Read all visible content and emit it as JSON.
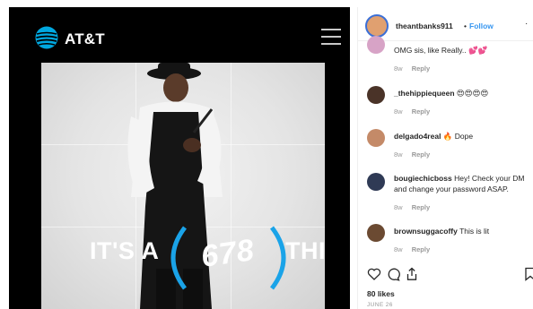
{
  "brand": {
    "name": "AT&T"
  },
  "media": {
    "tagline_left": "IT'S A",
    "tagline_number": "678",
    "tagline_right": "THING"
  },
  "post_header": {
    "username": "theantbanks911",
    "separator": "•",
    "follow_label": "Follow"
  },
  "comments": [
    {
      "username": "",
      "text": "OMG sis, like Really.. 💕💕",
      "age": "8w",
      "reply_label": "Reply"
    },
    {
      "username": "_thehippiequeen",
      "text": "😍😍😍😍",
      "age": "8w",
      "reply_label": "Reply"
    },
    {
      "username": "delgado4real",
      "text": "🔥 Dope",
      "age": "8w",
      "reply_label": "Reply"
    },
    {
      "username": "bougiechicboss",
      "text": "Hey! Check your DM",
      "text_line2": "and change your password ASAP.",
      "age": "8w",
      "reply_label": "Reply"
    },
    {
      "username": "brownsuggacoffy",
      "text": "This is lit",
      "age": "8w",
      "reply_label": "Reply"
    }
  ],
  "engagement": {
    "likes": "80 likes",
    "date": "JUNE 26"
  },
  "colors": {
    "accent_blue": "#3897f0",
    "att_blue": "#00a8e0",
    "text_dark": "#262626",
    "text_muted": "#999999"
  }
}
